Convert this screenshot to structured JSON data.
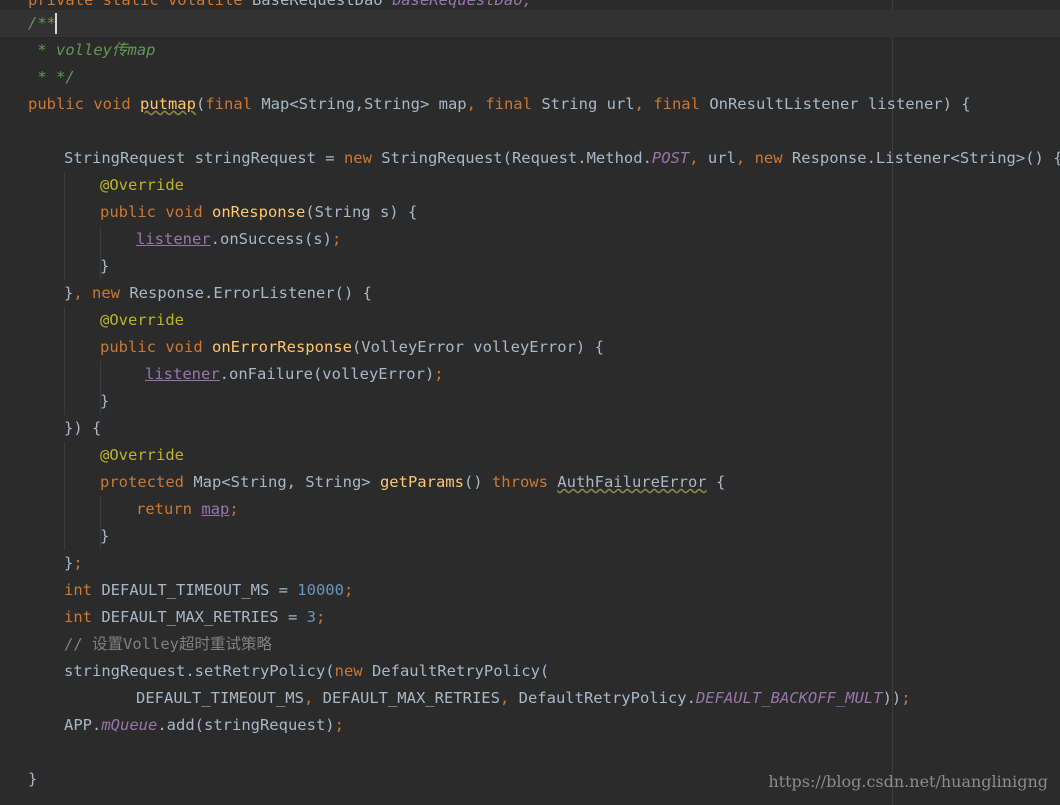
{
  "editor": {
    "lines": [
      [
        {
          "t": "private static volatile ",
          "c": "kw"
        },
        {
          "t": "BaseRequestDao ",
          "c": "plain"
        },
        {
          "t": "baseRequestDao;",
          "c": "static"
        }
      ],
      [
        {
          "t": "/**",
          "c": "doc"
        }
      ],
      [
        {
          "t": " * volley传map",
          "c": "doc"
        }
      ],
      [
        {
          "t": " * */",
          "c": "doc"
        }
      ],
      [
        {
          "t": "public void ",
          "c": "kw"
        },
        {
          "t": "putmap",
          "c": "fn wavy"
        },
        {
          "t": "(",
          "c": "plain"
        },
        {
          "t": "final ",
          "c": "kw"
        },
        {
          "t": "Map<String,String> map",
          "c": "plain"
        },
        {
          "t": ", ",
          "c": "kw"
        },
        {
          "t": "final ",
          "c": "kw"
        },
        {
          "t": "String url",
          "c": "plain"
        },
        {
          "t": ", ",
          "c": "kw"
        },
        {
          "t": "final ",
          "c": "kw"
        },
        {
          "t": "OnResultListener listener) {",
          "c": "plain"
        }
      ],
      [],
      [
        {
          "t": "StringRequest stringRequest = ",
          "c": "plain"
        },
        {
          "t": "new ",
          "c": "kw"
        },
        {
          "t": "StringRequest(Request.Method.",
          "c": "plain"
        },
        {
          "t": "POST",
          "c": "static"
        },
        {
          "t": ", ",
          "c": "kw"
        },
        {
          "t": "url",
          "c": "plain"
        },
        {
          "t": ", ",
          "c": "kw"
        },
        {
          "t": "new ",
          "c": "kw"
        },
        {
          "t": "Response.Listener<String>() {",
          "c": "plain"
        }
      ],
      [
        {
          "t": "@Override",
          "c": "ann"
        }
      ],
      [
        {
          "t": "public void ",
          "c": "kw"
        },
        {
          "t": "onResponse",
          "c": "fn"
        },
        {
          "t": "(String s) {",
          "c": "plain"
        }
      ],
      [
        {
          "t": "listener",
          "c": "field ul"
        },
        {
          "t": ".onSuccess(s)",
          "c": "plain"
        },
        {
          "t": ";",
          "c": "kw"
        }
      ],
      [
        {
          "t": "}",
          "c": "plain"
        }
      ],
      [
        {
          "t": "}",
          "c": "plain"
        },
        {
          "t": ", ",
          "c": "kw"
        },
        {
          "t": "new ",
          "c": "kw"
        },
        {
          "t": "Response.ErrorListener() {",
          "c": "plain"
        }
      ],
      [
        {
          "t": "@Override",
          "c": "ann"
        }
      ],
      [
        {
          "t": "public void ",
          "c": "kw"
        },
        {
          "t": "onErrorResponse",
          "c": "fn"
        },
        {
          "t": "(VolleyError volleyError) {",
          "c": "plain"
        }
      ],
      [
        {
          "t": "listener",
          "c": "field ul"
        },
        {
          "t": ".onFailure(volleyError)",
          "c": "plain"
        },
        {
          "t": ";",
          "c": "kw"
        }
      ],
      [
        {
          "t": "}",
          "c": "plain"
        }
      ],
      [
        {
          "t": "}) {",
          "c": "plain"
        }
      ],
      [
        {
          "t": "@Override",
          "c": "ann"
        }
      ],
      [
        {
          "t": "protected ",
          "c": "kw"
        },
        {
          "t": "Map<String, String> ",
          "c": "plain"
        },
        {
          "t": "getParams",
          "c": "fn"
        },
        {
          "t": "() ",
          "c": "plain"
        },
        {
          "t": "throws ",
          "c": "kw"
        },
        {
          "t": "AuthFailureError",
          "c": "plain wavy"
        },
        {
          "t": " {",
          "c": "plain"
        }
      ],
      [
        {
          "t": "return ",
          "c": "kw"
        },
        {
          "t": "map",
          "c": "field ul"
        },
        {
          "t": ";",
          "c": "kw"
        }
      ],
      [
        {
          "t": "}",
          "c": "plain"
        }
      ],
      [
        {
          "t": "}",
          "c": "plain"
        },
        {
          "t": ";",
          "c": "kw"
        }
      ],
      [
        {
          "t": "int ",
          "c": "kw"
        },
        {
          "t": "DEFAULT_TIMEOUT_MS = ",
          "c": "plain"
        },
        {
          "t": "10000",
          "c": "num"
        },
        {
          "t": ";",
          "c": "kw"
        }
      ],
      [
        {
          "t": "int ",
          "c": "kw"
        },
        {
          "t": "DEFAULT_MAX_RETRIES = ",
          "c": "plain"
        },
        {
          "t": "3",
          "c": "num"
        },
        {
          "t": ";",
          "c": "kw"
        }
      ],
      [
        {
          "t": "// 设置Volley超时重试策略",
          "c": "cmt"
        }
      ],
      [
        {
          "t": "stringRequest.setRetryPolicy(",
          "c": "plain"
        },
        {
          "t": "new ",
          "c": "kw"
        },
        {
          "t": "DefaultRetryPolicy(",
          "c": "plain"
        }
      ],
      [
        {
          "t": "DEFAULT_TIMEOUT_MS",
          "c": "plain"
        },
        {
          "t": ", ",
          "c": "kw"
        },
        {
          "t": "DEFAULT_MAX_RETRIES",
          "c": "plain"
        },
        {
          "t": ", ",
          "c": "kw"
        },
        {
          "t": "DefaultRetryPolicy.",
          "c": "plain"
        },
        {
          "t": "DEFAULT_BACKOFF_MULT",
          "c": "static"
        },
        {
          "t": "))",
          "c": "plain"
        },
        {
          "t": ";",
          "c": "kw"
        }
      ],
      [
        {
          "t": "APP.",
          "c": "plain"
        },
        {
          "t": "mQueue",
          "c": "static"
        },
        {
          "t": ".add(stringRequest)",
          "c": "plain"
        },
        {
          "t": ";",
          "c": "kw"
        }
      ],
      [],
      [
        {
          "t": "}",
          "c": "plain"
        }
      ]
    ]
  },
  "watermark": "https://blog.csdn.net/huanglinigng"
}
